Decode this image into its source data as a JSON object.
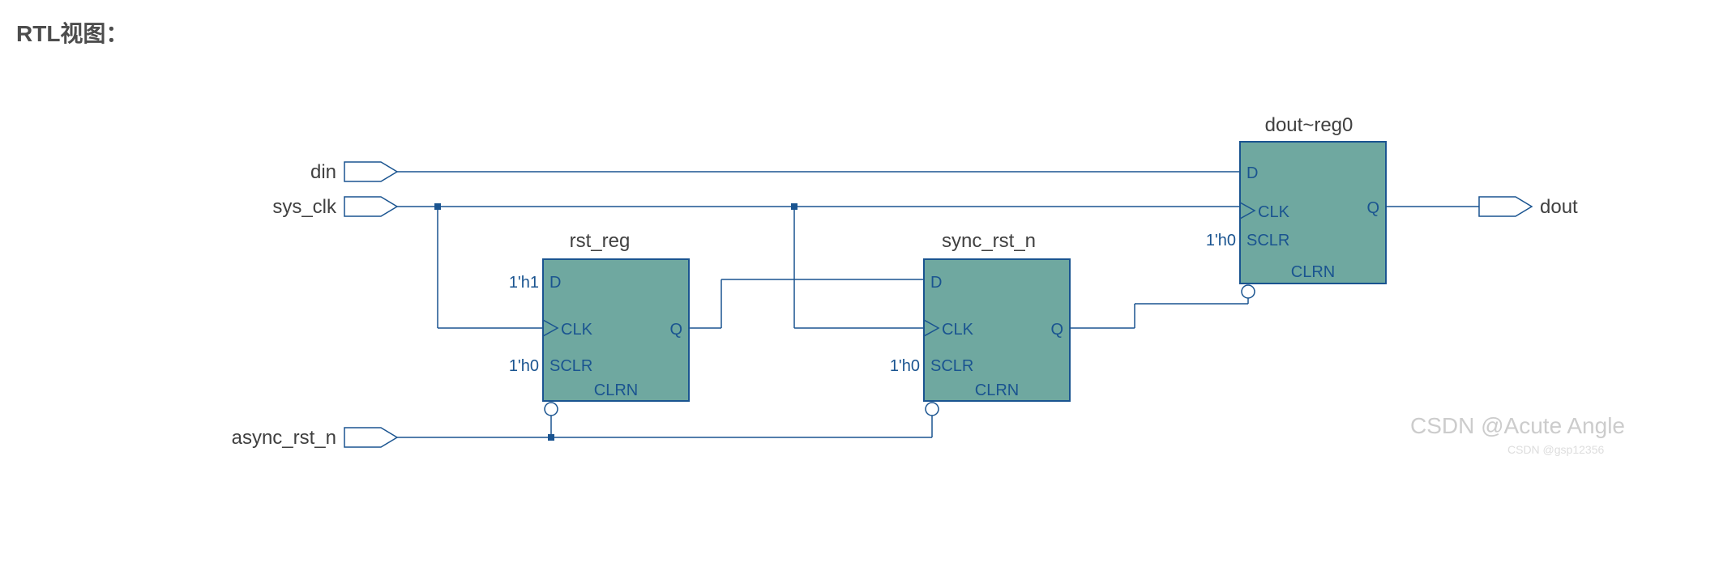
{
  "title": "RTL视图：",
  "inputs": {
    "din": "din",
    "sys_clk": "sys_clk",
    "async_rst_n": "async_rst_n"
  },
  "outputs": {
    "dout": "dout"
  },
  "blocks": {
    "rst_reg": {
      "name": "rst_reg",
      "d_const": "1'h1",
      "sclr_const": "1'h0",
      "pins": {
        "D": "D",
        "CLK": "CLK",
        "SCLR": "SCLR",
        "CLRN": "CLRN",
        "Q": "Q"
      }
    },
    "sync_rst_n": {
      "name": "sync_rst_n",
      "sclr_const": "1'h0",
      "pins": {
        "D": "D",
        "CLK": "CLK",
        "SCLR": "SCLR",
        "CLRN": "CLRN",
        "Q": "Q"
      }
    },
    "dout_reg0": {
      "name": "dout~reg0",
      "sclr_const": "1'h0",
      "pins": {
        "D": "D",
        "CLK": "CLK",
        "SCLR": "SCLR",
        "CLRN": "CLRN",
        "Q": "Q"
      }
    }
  },
  "watermark": "CSDN @Acute Angle",
  "watermark_small": "CSDN @gsp12356"
}
